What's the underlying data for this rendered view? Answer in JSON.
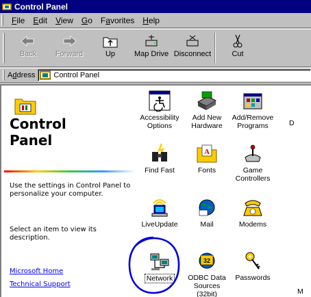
{
  "window": {
    "title": "Control Panel"
  },
  "menu": [
    {
      "key": "F",
      "rest": "ile"
    },
    {
      "key": "E",
      "rest": "dit"
    },
    {
      "key": "V",
      "rest": "iew"
    },
    {
      "key": "G",
      "rest": "o"
    },
    {
      "pre": "F",
      "key": "a",
      "rest": "vorites"
    },
    {
      "key": "H",
      "rest": "elp"
    }
  ],
  "toolbar": {
    "back": "Back",
    "forward": "Forward",
    "up": "Up",
    "map_drive": "Map Drive",
    "disconnect": "Disconnect",
    "cut": "Cut"
  },
  "address": {
    "label_pre": "A",
    "label_key": "d",
    "label_rest": "dress",
    "value": "Control Panel"
  },
  "left": {
    "title_line1": "Control",
    "title_line2": "Panel",
    "desc1": "Use the settings in Control Panel to personalize your computer.",
    "desc2": "Select an item to view its description.",
    "link1": "Microsoft Home",
    "link2": "Technical Support"
  },
  "items": [
    {
      "label": "Accessibility Options"
    },
    {
      "label": "Add New Hardware"
    },
    {
      "label": "Add/Remove Programs"
    },
    {
      "label": "Find Fast"
    },
    {
      "label": "Fonts"
    },
    {
      "label": "Game Controllers"
    },
    {
      "label": "LiveUpdate"
    },
    {
      "label": "Mail"
    },
    {
      "label": "Modems"
    },
    {
      "label": "Network"
    },
    {
      "label": "ODBC Data Sources (32bit)"
    },
    {
      "label": "Passwords"
    }
  ],
  "cut_off": {
    "d": "D",
    "m": "M"
  }
}
